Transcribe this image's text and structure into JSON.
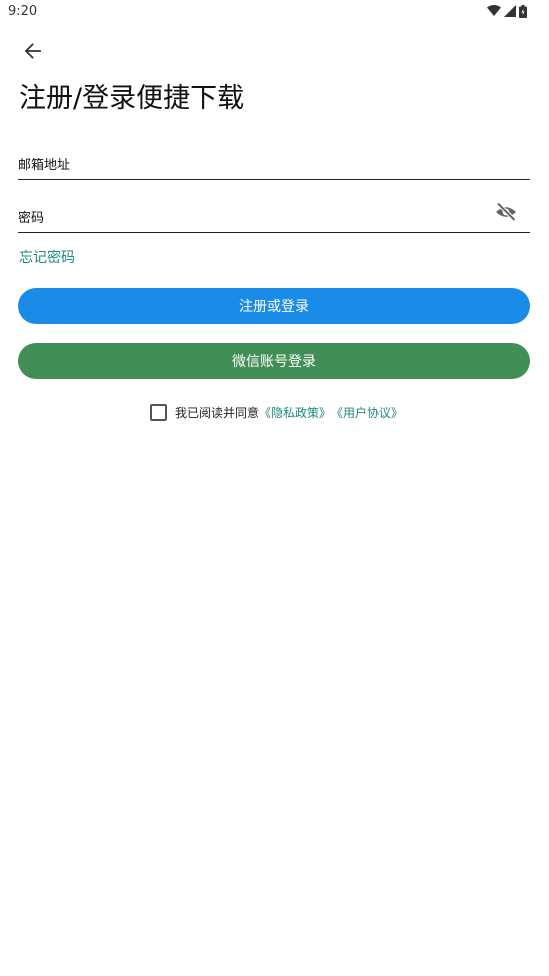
{
  "status_bar": {
    "time": "9:20"
  },
  "header": {
    "back_icon": "arrow-left-icon",
    "title": "注册/登录便捷下载"
  },
  "form": {
    "email_placeholder": "邮箱地址",
    "password_placeholder": "密码",
    "password_toggle_icon": "eye-off-icon",
    "forgot_label": "忘记密码"
  },
  "buttons": {
    "register_login": "注册或登录",
    "wechat_login": "微信账号登录"
  },
  "agreement": {
    "checked": false,
    "text": "我已阅读并同意",
    "privacy_policy": "《隐私政策》",
    "user_agreement": "《用户协议》"
  },
  "colors": {
    "primary_button": "#1a8ce8",
    "wechat_button": "#418e56",
    "link": "#1c8a7a"
  }
}
